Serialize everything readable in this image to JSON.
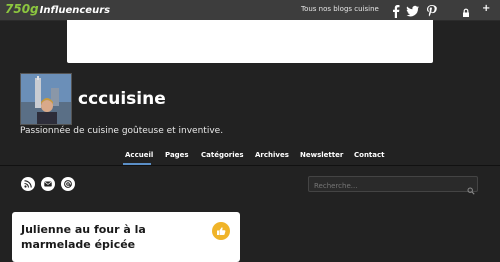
{
  "topbar": {
    "brand_number": "750g",
    "brand_name": "Influenceurs",
    "all_blogs_link": "Tous nos blogs cuisine",
    "icons": [
      "facebook-icon",
      "twitter-icon",
      "pinterest-icon",
      "lock-icon",
      "plus-icon"
    ]
  },
  "header": {
    "title": "cccuisine",
    "tagline": "Passionnée de cuisine goûteuse et inventive."
  },
  "nav": {
    "items": [
      "Accueil",
      "Pages",
      "Catégories",
      "Archives",
      "Newsletter",
      "Contact"
    ],
    "active": "Accueil"
  },
  "follow": {
    "icons": [
      "rss-icon",
      "email-icon",
      "at-icon"
    ]
  },
  "search": {
    "placeholder": "Recherche..."
  },
  "post": {
    "title": "Julienne au four à la marmelade épicée",
    "badge_icon": "like-icon"
  },
  "colors": {
    "background": "#222222",
    "topbar": "#3d3d3d",
    "brand_green": "#8cc63f",
    "nav_active": "#5b8fc7",
    "badge": "#f0b429"
  }
}
